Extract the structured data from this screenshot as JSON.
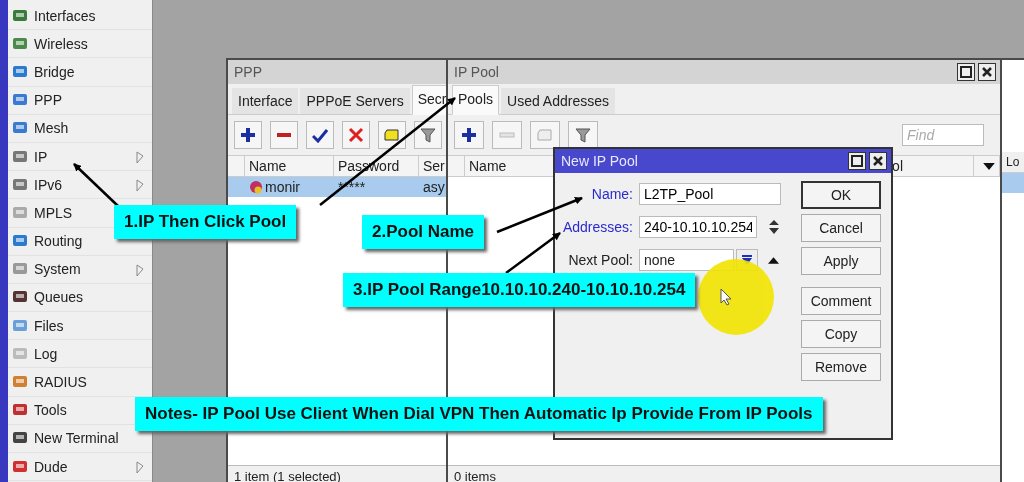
{
  "sidebar": {
    "items": [
      {
        "label": "Interfaces",
        "submenu": false
      },
      {
        "label": "Wireless",
        "submenu": false
      },
      {
        "label": "Bridge",
        "submenu": false
      },
      {
        "label": "PPP",
        "submenu": false
      },
      {
        "label": "Mesh",
        "submenu": false
      },
      {
        "label": "IP",
        "submenu": true
      },
      {
        "label": "IPv6",
        "submenu": true
      },
      {
        "label": "MPLS",
        "submenu": false
      },
      {
        "label": "Routing",
        "submenu": false
      },
      {
        "label": "System",
        "submenu": true
      },
      {
        "label": "Queues",
        "submenu": false
      },
      {
        "label": "Files",
        "submenu": false
      },
      {
        "label": "Log",
        "submenu": false
      },
      {
        "label": "RADIUS",
        "submenu": false
      },
      {
        "label": "Tools",
        "submenu": false
      },
      {
        "label": "New Terminal",
        "submenu": false
      },
      {
        "label": "Dude",
        "submenu": true
      }
    ]
  },
  "ppp_window": {
    "title": "PPP",
    "tabs": [
      {
        "label": "Interface",
        "selected": false
      },
      {
        "label": "PPPoE Servers",
        "selected": false
      },
      {
        "label": "Secr",
        "selected": true
      }
    ],
    "toolbar": [
      {
        "kind": "add",
        "disabled": false
      },
      {
        "kind": "remove",
        "disabled": false
      },
      {
        "kind": "enable",
        "disabled": false
      },
      {
        "kind": "disable",
        "disabled": false
      },
      {
        "kind": "comment",
        "disabled": false
      },
      {
        "kind": "filter",
        "disabled": false
      }
    ],
    "columns": [
      "Name",
      "Password",
      "Ser"
    ],
    "rows": [
      {
        "name": "monir",
        "password": "*****",
        "service": "asy",
        "selected": true
      }
    ],
    "status": "1 item (1 selected)"
  },
  "ip_pool_window": {
    "title": "IP Pool",
    "tabs": [
      {
        "label": "Pools",
        "selected": true
      },
      {
        "label": "Used Addresses",
        "selected": false
      }
    ],
    "toolbar": [
      {
        "kind": "add",
        "disabled": false
      },
      {
        "kind": "remove",
        "disabled": true
      },
      {
        "kind": "comment",
        "disabled": true
      },
      {
        "kind": "filter",
        "disabled": false
      }
    ],
    "search": {
      "placeholder": "Find"
    },
    "columns": [
      "Name",
      "ol"
    ],
    "status": "0 items"
  },
  "right_window": {
    "columns": [
      "Lo"
    ]
  },
  "dialog": {
    "title": "New IP Pool",
    "fields": [
      {
        "kind": "text",
        "label": "Name:",
        "required": true,
        "value": "L2TP_Pool"
      },
      {
        "kind": "range",
        "label": "Addresses:",
        "required": true,
        "value": "240-10.10.10.254"
      },
      {
        "kind": "select",
        "label": "Next Pool:",
        "required": false,
        "value": "none"
      }
    ],
    "buttons": [
      "OK",
      "Cancel",
      "Apply",
      "Comment",
      "Copy",
      "Remove"
    ]
  },
  "callouts": [
    {
      "text": "1.IP Then Click Pool"
    },
    {
      "text": "2.Pool Name"
    },
    {
      "text": "3.IP Pool Range10.10.10.240-10.10.10.254"
    },
    {
      "text": "Notes- IP Pool Use Client When Dial VPN Then Automatic Ip Provide From IP Pools"
    }
  ]
}
